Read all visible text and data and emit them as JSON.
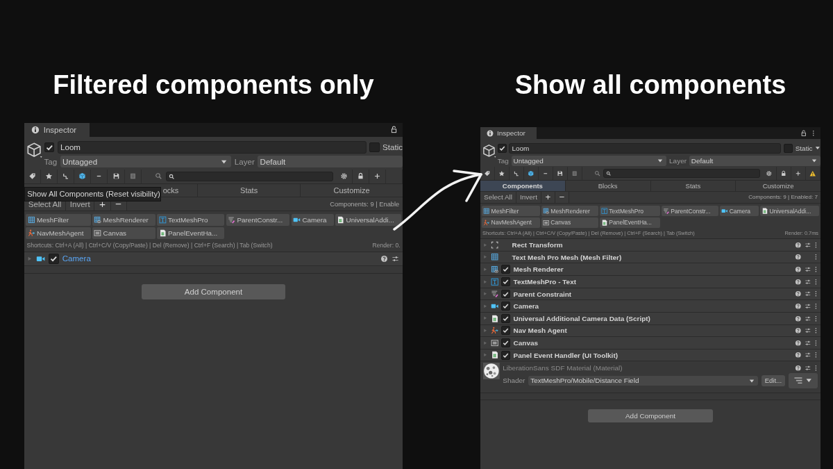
{
  "panels": [
    {
      "kind": "zoomed",
      "heading": "Filtered components only",
      "tab": "Inspector",
      "object": {
        "name": "Loom",
        "active": true,
        "static": false,
        "static_label": "Static",
        "tag_label": "Tag",
        "tag": "Untagged",
        "layer_label": "Layer",
        "layer": "Default"
      },
      "tooltip": "Show All Components (Reset visibility)",
      "tabs": [
        {
          "label": "ocks",
          "selected": false
        },
        {
          "label": "Stats",
          "selected": false
        },
        {
          "label": "Customize",
          "selected": false
        }
      ],
      "actions": [
        "Select All",
        "Invert",
        "+",
        "−"
      ],
      "status": "Components: 9 | Enable",
      "chips": [
        {
          "label": "MeshFilter",
          "kind": "mesh"
        },
        {
          "label": "MeshRenderer",
          "kind": "renderer"
        },
        {
          "label": "TextMeshPro",
          "kind": "text"
        },
        {
          "label": "ParentConstr...",
          "kind": "constraint"
        },
        {
          "label": "Camera",
          "kind": "camera"
        },
        {
          "label": "UniversalAddi...",
          "kind": "script"
        },
        {
          "label": "NavMeshAgent",
          "kind": "agent"
        },
        {
          "label": "Canvas",
          "kind": "canvas"
        },
        {
          "label": "PanelEventHa...",
          "kind": "script"
        }
      ],
      "shortcuts": "Shortcuts: Ctrl+A (All) | Ctrl+C/V (Copy/Paste) | Del (Remove) | Ctrl+F (Search) | Tab (Switch)",
      "render": "Render: 0.",
      "components": [
        {
          "name": "Camera",
          "kind": "camera",
          "checked": true,
          "selected": true,
          "presets": true
        }
      ],
      "add_button": "Add Component"
    },
    {
      "kind": "full",
      "heading": "Show all components",
      "tab": "Inspector",
      "object": {
        "name": "Loom",
        "active": true,
        "static": false,
        "static_label": "Static",
        "tag_label": "Tag",
        "tag": "Untagged",
        "layer_label": "Layer",
        "layer": "Default"
      },
      "tabs": [
        {
          "label": "Components",
          "selected": true
        },
        {
          "label": "Blocks",
          "selected": false
        },
        {
          "label": "Stats",
          "selected": false
        },
        {
          "label": "Customize",
          "selected": false
        }
      ],
      "actions": [
        "Select All",
        "Invert",
        "+",
        "−"
      ],
      "status": "Components: 9 | Enabled: 7",
      "chips": [
        {
          "label": "MeshFilter",
          "kind": "mesh"
        },
        {
          "label": "MeshRenderer",
          "kind": "renderer"
        },
        {
          "label": "TextMeshPro",
          "kind": "text"
        },
        {
          "label": "ParentConstr...",
          "kind": "constraint"
        },
        {
          "label": "Camera",
          "kind": "camera"
        },
        {
          "label": "UniversalAddi...",
          "kind": "script"
        },
        {
          "label": "NavMeshAgent",
          "kind": "agent"
        },
        {
          "label": "Canvas",
          "kind": "canvas"
        },
        {
          "label": "PanelEventHa...",
          "kind": "script"
        }
      ],
      "shortcuts": "Shortcuts: Ctrl+A (All) | Ctrl+C/V (Copy/Paste) | Del (Remove) | Ctrl+F (Search) | Tab (Switch)",
      "render": "Render: 0.7ms",
      "components": [
        {
          "name": "Rect Transform",
          "kind": "transform",
          "selected": false,
          "presets": true
        },
        {
          "name": "Text Mesh Pro Mesh (Mesh Filter)",
          "kind": "mesh",
          "selected": false,
          "presets": false
        },
        {
          "name": "Mesh Renderer",
          "kind": "renderer",
          "checked": true,
          "selected": false,
          "presets": true
        },
        {
          "name": "TextMeshPro - Text",
          "kind": "text",
          "checked": true,
          "selected": false,
          "presets": true
        },
        {
          "name": "Parent Constraint",
          "kind": "constraint",
          "checked": true,
          "selected": false,
          "presets": true
        },
        {
          "name": "Camera",
          "kind": "camera",
          "checked": true,
          "selected": false,
          "presets": true
        },
        {
          "name": "Universal Additional Camera Data (Script)",
          "kind": "script",
          "checked": true,
          "selected": false,
          "presets": true
        },
        {
          "name": "Nav Mesh Agent",
          "kind": "agent",
          "checked": true,
          "selected": false,
          "presets": true
        },
        {
          "name": "Canvas",
          "kind": "canvas",
          "checked": true,
          "selected": false,
          "presets": true
        },
        {
          "name": "Panel Event Handler (UI Toolkit)",
          "kind": "script",
          "checked": true,
          "selected": false,
          "presets": true
        }
      ],
      "material": {
        "name": "LiberationSans SDF Material (Material)",
        "shader_label": "Shader",
        "shader": "TextMeshPro/Mobile/Distance Field",
        "edit": "Edit..."
      },
      "add_button": "Add Component"
    }
  ]
}
